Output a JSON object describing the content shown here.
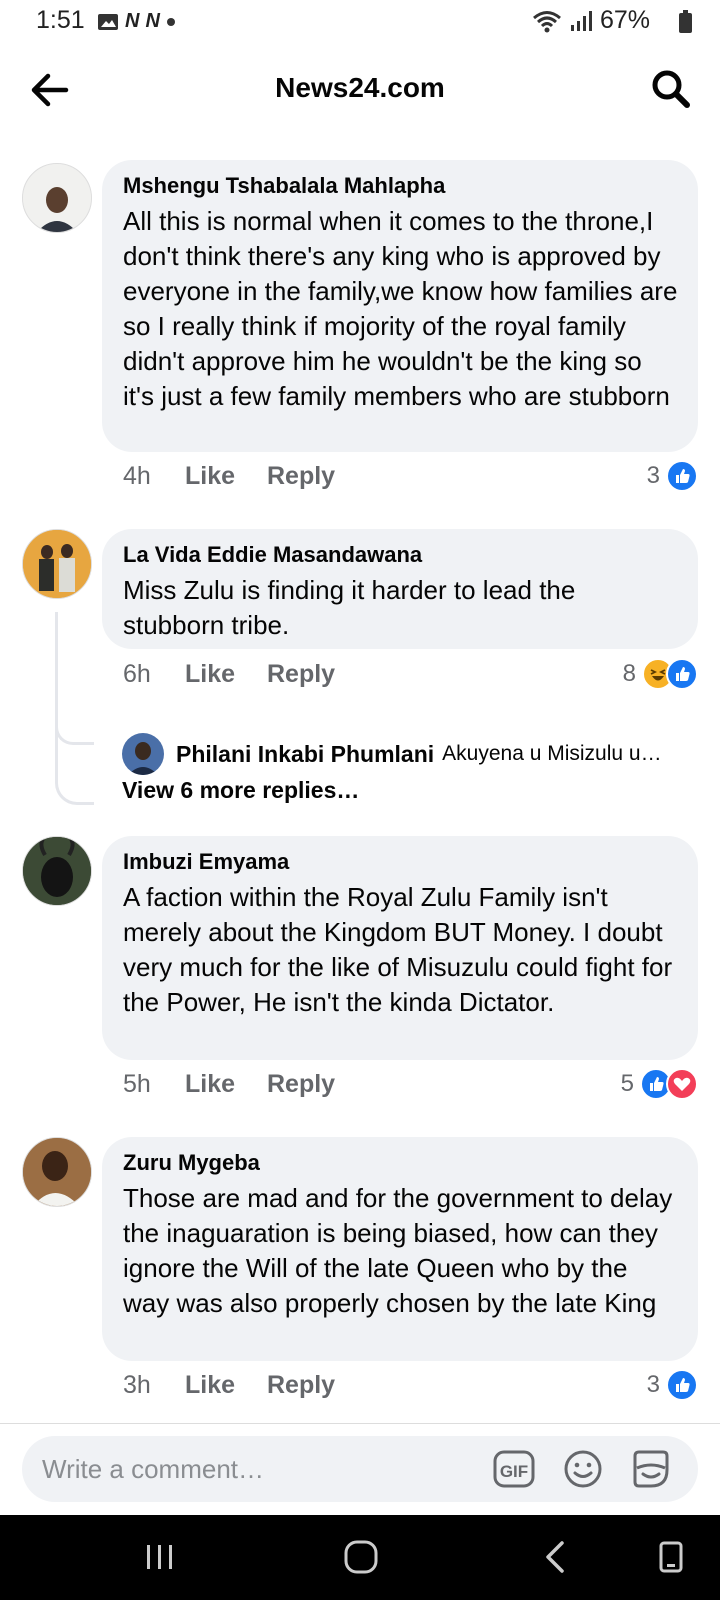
{
  "status_bar": {
    "time": "1:51",
    "left_icons": [
      "image-icon",
      "n-icon",
      "n-icon",
      "dot-icon"
    ],
    "battery_percent": "67%",
    "right_icons": [
      "wifi-icon",
      "signal-icon",
      "battery-icon"
    ]
  },
  "header": {
    "title": "News24.com",
    "back_icon": "arrow-left-icon",
    "search_icon": "search-icon"
  },
  "comments": [
    {
      "author": "Mshengu Tshabalala Mahlapha",
      "text": "All this is normal when it comes to the throne,I don't think there's any king who is approved by everyone in the family,we know how families are so I really think if mojority of the royal family didn't approve him he wouldn't be the king so it's just a few family members who are stubborn",
      "time": "4h",
      "like_label": "Like",
      "reply_label": "Reply",
      "reaction_count": "3",
      "reactions": [
        "like"
      ]
    },
    {
      "author": "La Vida Eddie Masandawana",
      "text": "Miss Zulu is finding it harder to lead the stubborn tribe.",
      "time": "6h",
      "like_label": "Like",
      "reply_label": "Reply",
      "reaction_count": "8",
      "reactions": [
        "haha",
        "like"
      ],
      "reply_preview": {
        "author": "Philani Inkabi Phumlani",
        "text": "Akuyena u Misizulu u…"
      },
      "view_more_label": "View 6 more replies…"
    },
    {
      "author": "Imbuzi Emyama",
      "text": "A faction within the Royal Zulu Family isn't merely about the Kingdom BUT Money. I doubt very much for the like of Misuzulu could fight for  the Power, He isn't the kinda Dictator.",
      "time": "5h",
      "like_label": "Like",
      "reply_label": "Reply",
      "reaction_count": "5",
      "reactions": [
        "like",
        "love"
      ]
    },
    {
      "author": "Zuru Mygeba",
      "text": "Those are mad and for the government to delay the inaguaration is being biased, how can they ignore the Will of the late Queen who by the way was also properly chosen by the late King",
      "time": "3h",
      "like_label": "Like",
      "reply_label": "Reply",
      "reaction_count": "3",
      "reactions": [
        "like"
      ]
    }
  ],
  "composer": {
    "placeholder": "Write a comment…",
    "gif_label": "GIF",
    "icons": [
      "gif-icon",
      "emoji-icon",
      "sticker-icon"
    ]
  },
  "nav_bar": {
    "buttons": [
      "recents-icon",
      "home-icon",
      "back-icon",
      "screenshot-icon"
    ]
  },
  "colors": {
    "bubble": "#f0f2f5",
    "meta_text": "#65676b",
    "like_blue": "#1877f2",
    "love_red": "#f33e58",
    "haha_yellow": "#f7b125"
  }
}
